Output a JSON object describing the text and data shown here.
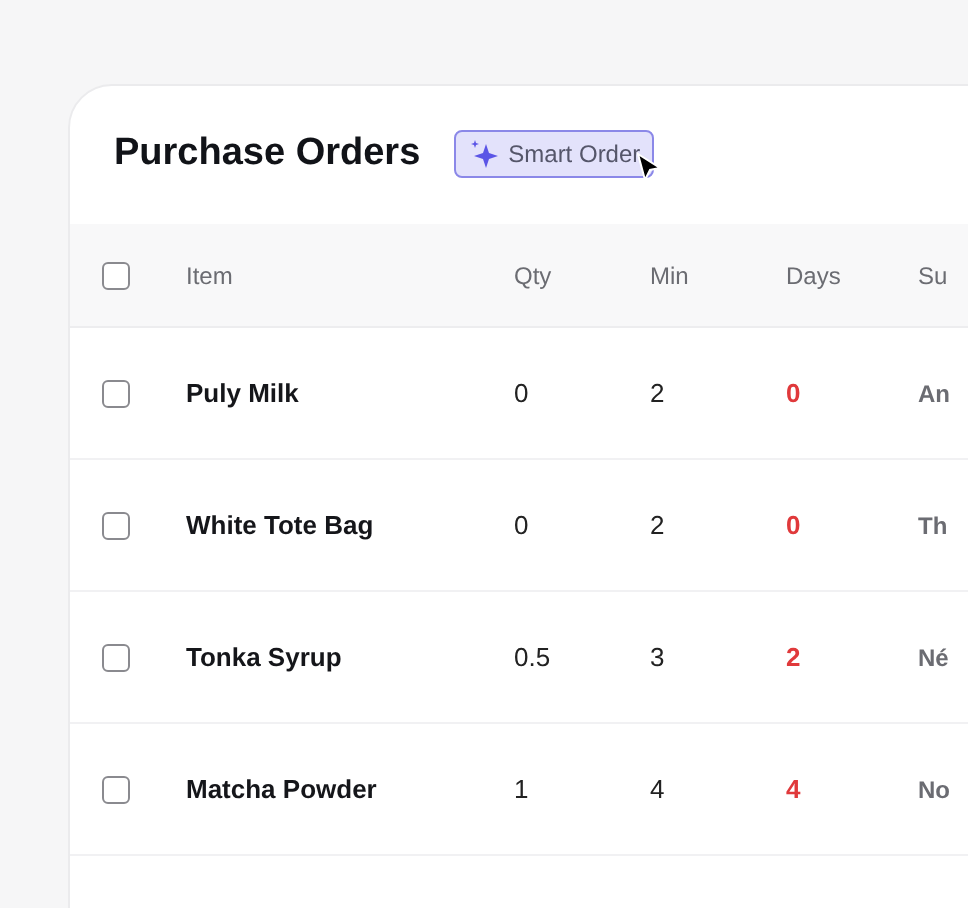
{
  "title": "Purchase Orders",
  "smart_order_button": {
    "label": "Smart Order"
  },
  "table": {
    "select_all": {
      "checked": false
    },
    "columns": [
      "Item",
      "Qty",
      "Min",
      "Days",
      "Su"
    ],
    "rows": [
      {
        "checked": false,
        "item": "Puly Milk",
        "qty": "0",
        "min": "2",
        "days": "0",
        "column_5": "An"
      },
      {
        "checked": false,
        "item": "White Tote Bag",
        "qty": "0",
        "min": "2",
        "days": "0",
        "column_5": "Th"
      },
      {
        "checked": false,
        "item": "Tonka Syrup",
        "qty": "0.5",
        "min": "3",
        "days": "2",
        "column_5": "Né"
      },
      {
        "checked": false,
        "item": "Matcha Powder",
        "qty": "1",
        "min": "4",
        "days": "4",
        "column_5": "No"
      }
    ]
  }
}
